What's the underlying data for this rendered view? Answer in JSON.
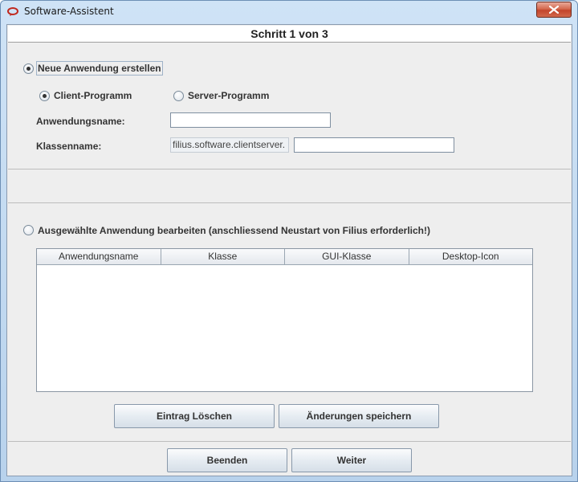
{
  "window": {
    "title": "Software-Assistent"
  },
  "step": {
    "label": "Schritt 1 von 3"
  },
  "create": {
    "option_label": "Neue Anwendung erstellen",
    "client_label": "Client-Programm",
    "server_label": "Server-Programm",
    "app_name_label": "Anwendungsname:",
    "app_name_value": "",
    "class_name_label": "Klassenname:",
    "class_prefix": "filius.software.clientserver.",
    "class_name_value": ""
  },
  "edit": {
    "option_label": "Ausgewählte Anwendung bearbeiten (anschliessend Neustart von Filius erforderlich!)",
    "columns": [
      "Anwendungsname",
      "Klasse",
      "GUI-Klasse",
      "Desktop-Icon"
    ],
    "rows": [],
    "delete_button": "Eintrag Löschen",
    "save_button": "Änderungen speichern"
  },
  "footer": {
    "quit_button": "Beenden",
    "next_button": "Weiter"
  },
  "colors": {
    "close_button": "#c9452c",
    "panel_bg": "#eeeeee"
  }
}
